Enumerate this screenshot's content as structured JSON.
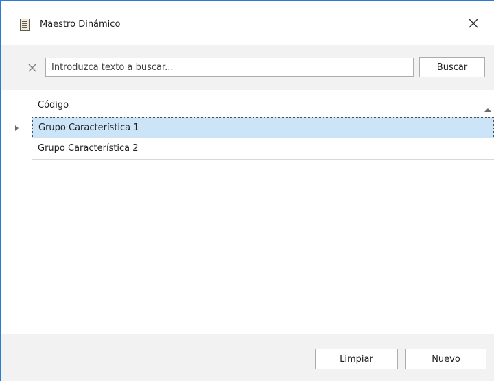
{
  "window": {
    "title": "Maestro Dinámico",
    "icon": "form-list-icon",
    "close_icon": "close-icon"
  },
  "search": {
    "clear_icon": "clear-icon",
    "placeholder": "Introduzca texto a buscar...",
    "value": "",
    "button_label": "Buscar"
  },
  "grid": {
    "columns": [
      {
        "label": "Código",
        "sort": "ascending"
      }
    ],
    "rows": [
      {
        "codigo": "Grupo Característica 1",
        "selected": true
      },
      {
        "codigo": "Grupo Característica 2",
        "selected": false
      }
    ]
  },
  "footer": {
    "clear_label": "Limpiar",
    "new_label": "Nuevo"
  },
  "colors": {
    "accent_border": "#2b7bd3",
    "selection": "#cce4f7",
    "panel": "#f2f2f2"
  }
}
